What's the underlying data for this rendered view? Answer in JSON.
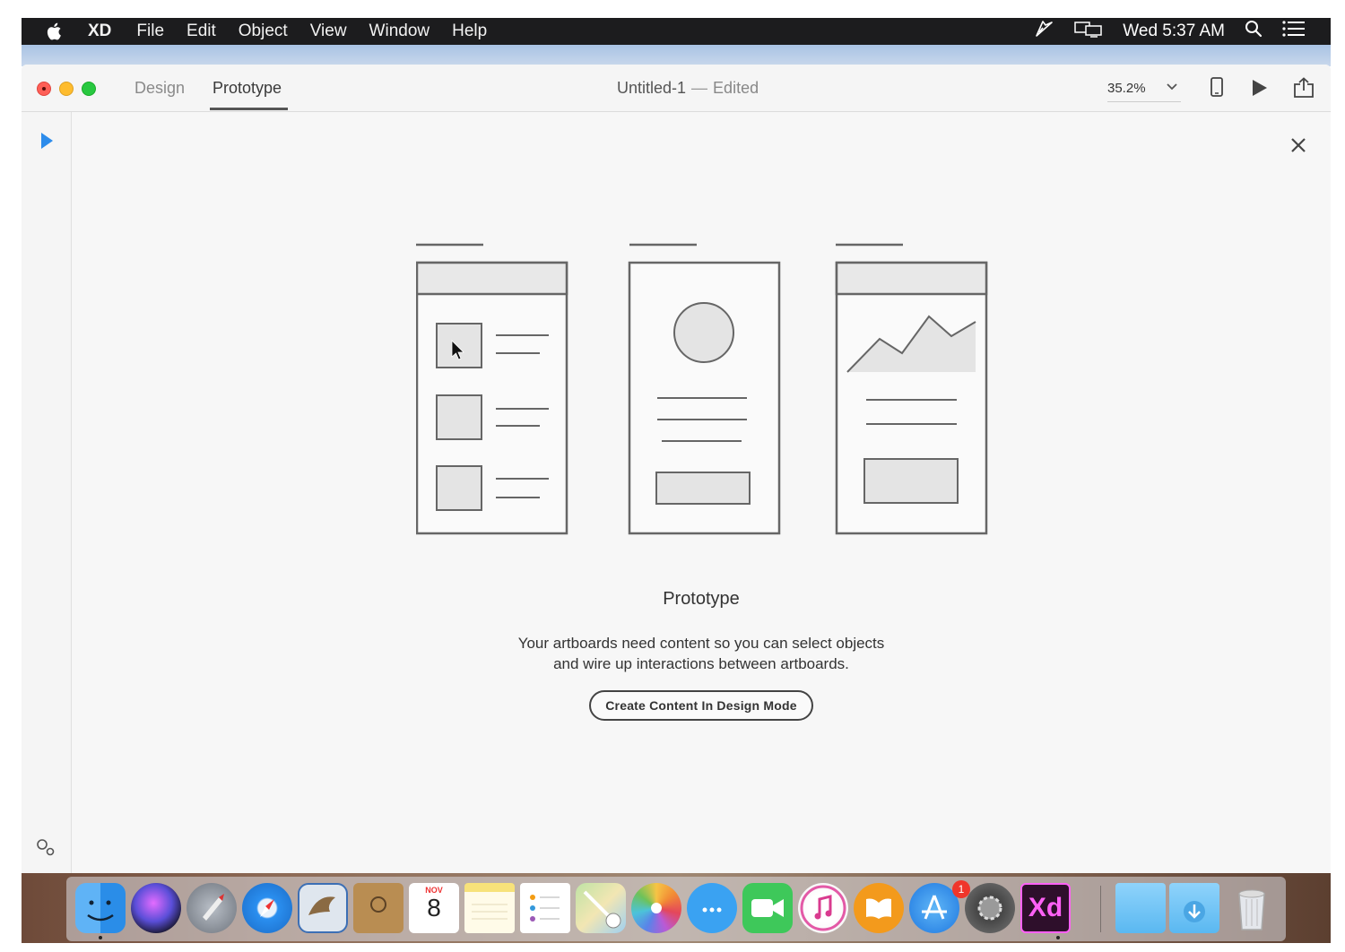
{
  "menubar": {
    "app_name": "XD",
    "items": [
      "File",
      "Edit",
      "Object",
      "View",
      "Window",
      "Help"
    ],
    "clock": "Wed 5:37 AM"
  },
  "window": {
    "tabs": {
      "design": "Design",
      "prototype": "Prototype",
      "active": "Prototype"
    },
    "doc_name": "Untitled-1",
    "separator": "—",
    "doc_status": "Edited",
    "zoom": "35.2%"
  },
  "empty_state": {
    "title": "Prototype",
    "description_line1": "Your artboards need content so you can select objects",
    "description_line2": "and wire up interactions between artboards.",
    "cta_label": "Create Content In Design Mode"
  },
  "dock": {
    "apps": [
      "Finder",
      "Siri",
      "Launchpad",
      "Safari",
      "Mail",
      "Contacts",
      "Calendar",
      "Notes",
      "Reminders",
      "Maps",
      "Photos",
      "Messages",
      "FaceTime",
      "iTunes",
      "iBooks",
      "App Store",
      "System Preferences",
      "Adobe XD",
      "Applications",
      "Downloads",
      "Trash"
    ],
    "calendar_month": "NOV",
    "calendar_day": "8",
    "appstore_badge": "1",
    "xd_label": "Xd"
  },
  "colors": {
    "menubar_bg": "#1c1c1e",
    "accent_blue": "#2d8ceb",
    "cta_border": "#444444",
    "window_bg": "#f7f7f7"
  }
}
